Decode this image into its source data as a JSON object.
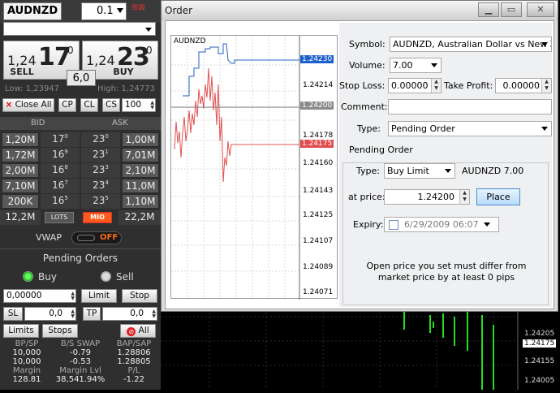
{
  "trade_panel": {
    "symbol": "AUDNZD",
    "quantity": "0.1",
    "sell": {
      "prefix": "1,24",
      "big": "17",
      "sup": "0",
      "label": "SELL"
    },
    "buy": {
      "prefix": "1,24",
      "big": "23",
      "sup": "0",
      "label": "BUY"
    },
    "spread": "6,0",
    "low": "Low: 1,23947",
    "high": "High: 1,24773",
    "close_all": "Close All",
    "cp": "CP",
    "cl": "CL",
    "cs": "CS",
    "cs_value": "100",
    "bid_header": "BID",
    "ask_header": "ASK",
    "depth": [
      {
        "bid_vol": "1,20M",
        "bid_big": "17",
        "bid_sup": "0",
        "ask_big": "23",
        "ask_sup": "0",
        "ask_vol": "1,00M"
      },
      {
        "bid_vol": "1,72M",
        "bid_big": "16",
        "bid_sup": "9",
        "ask_big": "23",
        "ask_sup": "1",
        "ask_vol": "7,01M"
      },
      {
        "bid_vol": "2,00M",
        "bid_big": "16",
        "bid_sup": "8",
        "ask_big": "23",
        "ask_sup": "3",
        "ask_vol": "2,10M"
      },
      {
        "bid_vol": "7,10M",
        "bid_big": "16",
        "bid_sup": "7",
        "ask_big": "23",
        "ask_sup": "4",
        "ask_vol": "11,0M"
      },
      {
        "bid_vol": "200K",
        "bid_big": "16",
        "bid_sup": "5",
        "ask_big": "23",
        "ask_sup": "5",
        "ask_vol": "1,10M"
      }
    ],
    "total_bid": "12,2M",
    "lots": "LOTS",
    "mio": "MIO",
    "total_ask": "22,2M",
    "vwap_label": "VWAP",
    "vwap_state": "OFF",
    "pending_title": "Pending Orders",
    "radio_buy": "Buy",
    "radio_sell": "Sell",
    "pending_price": "0,00000",
    "limit": "Limit",
    "stop": "Stop",
    "sl": "SL",
    "sl_value": "0,0",
    "tp": "TP",
    "tp_value": "0,0",
    "limits": "Limits",
    "stops": "Stops",
    "all": "All",
    "stats": {
      "h1": "BP/SP",
      "h2": "B/S SWAP",
      "h3": "BAP/SAP",
      "r1": [
        "10,000",
        "-0.79",
        "1.28806"
      ],
      "r2": [
        "10,000",
        "-0.53",
        "1.28805"
      ],
      "h4": "Margin",
      "h5": "Margin Lvl",
      "h6": "P/L",
      "r3": [
        "128.81",
        "38,541.94%",
        "-1.22"
      ]
    }
  },
  "dialog": {
    "title": "Order",
    "chart_symbol": "AUDNZD",
    "price_ticks": [
      "1.24230",
      "1.24214",
      "1.24200",
      "1.24178",
      "1.24175",
      "1.24160",
      "1.24143",
      "1.24125",
      "1.24107",
      "1.24089",
      "1.24071"
    ],
    "symbol_label": "Symbol:",
    "symbol_value": "AUDNZD, Australian Dollar vs New Zeal",
    "volume_label": "Volume:",
    "volume_value": "7.00",
    "stoploss_label": "Stop Loss:",
    "stoploss_value": "0.00000",
    "takeprofit_label": "Take Profit:",
    "takeprofit_value": "0.00000",
    "comment_label": "Comment:",
    "comment_value": "",
    "type_label": "Type:",
    "type_value": "Pending Order",
    "pending_group": "Pending Order",
    "ptype_label": "Type:",
    "ptype_value": "Buy Limit",
    "ptype_desc": "AUDNZD 7.00",
    "at_price_label": "at price:",
    "at_price_value": "1.24200",
    "place": "Place",
    "expiry_label": "Expiry:",
    "expiry_value": "6/29/2009 06:07",
    "note_line1": "Open price you set must differ from",
    "note_line2": "market price by at least 0 pips"
  },
  "bg_chart": {
    "ticks": [
      "1.24205",
      "1.24175",
      "1.24155",
      "1.24005"
    ]
  },
  "colors": {
    "bid_line": "#e05050",
    "ask_line": "#2060c0",
    "ask_tag": "#1d5fcc",
    "bid_tag": "#e24c4c",
    "mio_orange": "#ff5a1a"
  }
}
